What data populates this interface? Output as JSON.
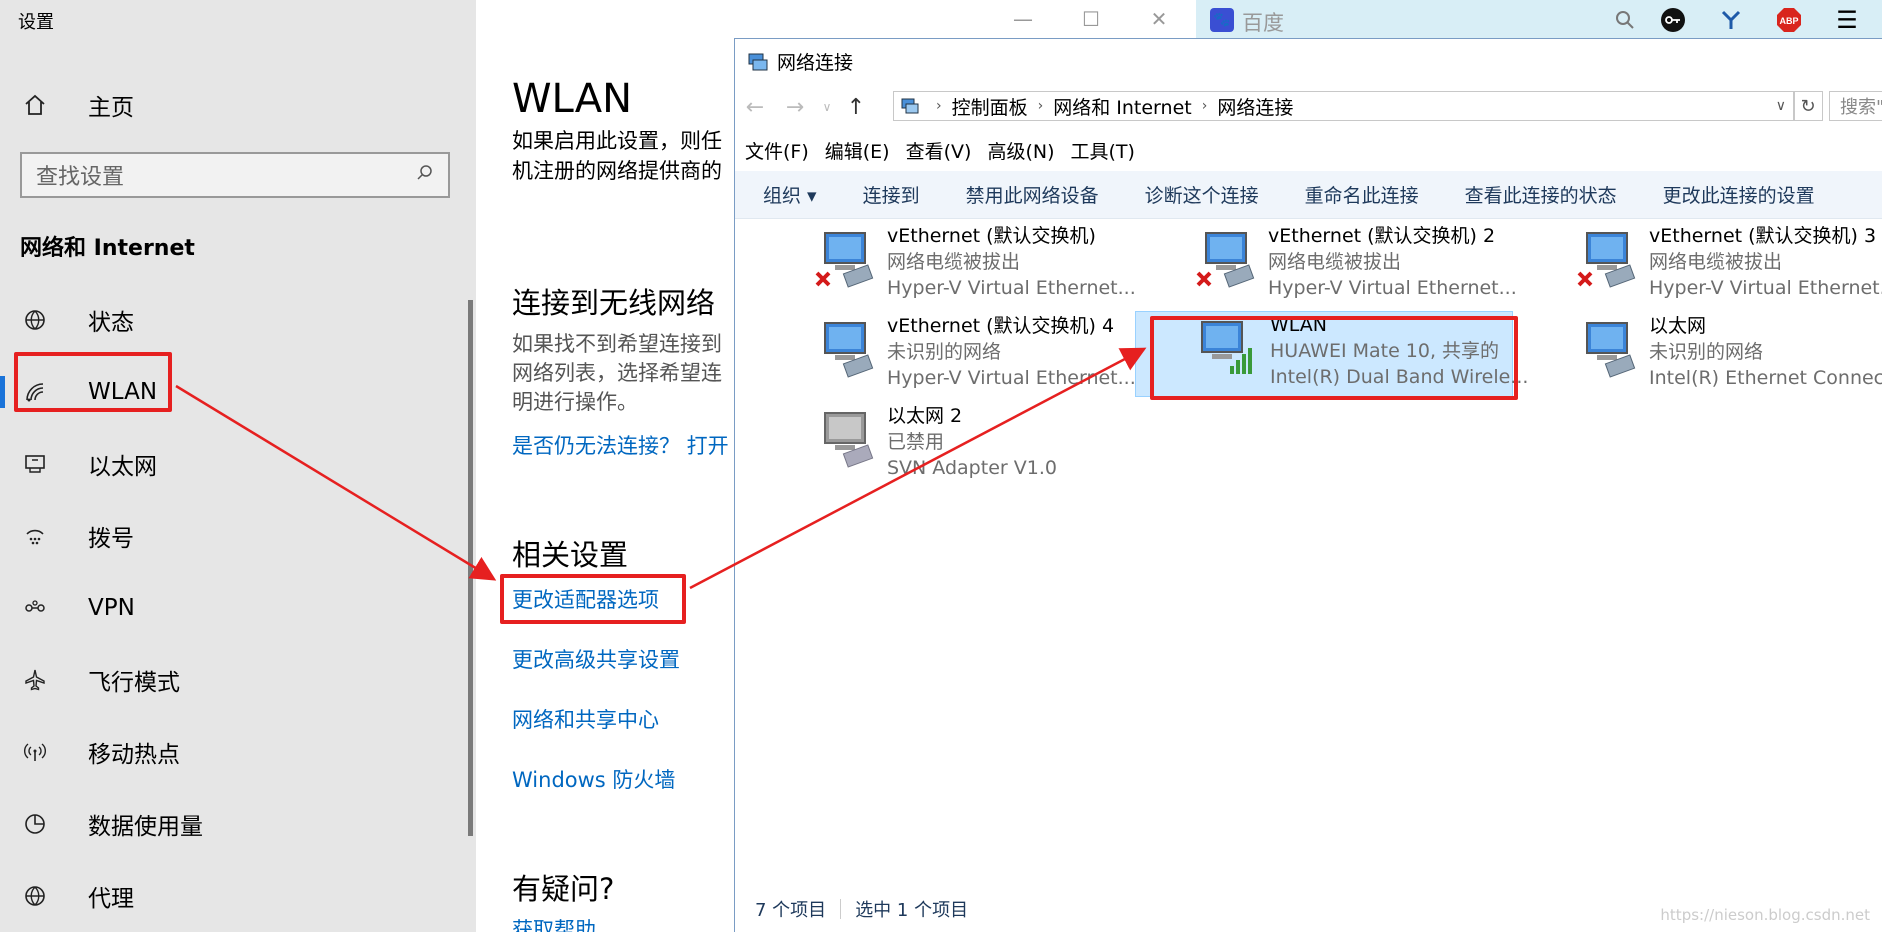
{
  "settings": {
    "window_title": "设置",
    "home_label": "主页",
    "search_placeholder": "查找设置",
    "section_heading": "网络和 Internet",
    "nav": [
      {
        "label": "状态",
        "icon": "globe-status-icon"
      },
      {
        "label": "WLAN",
        "icon": "wifi-icon"
      },
      {
        "label": "以太网",
        "icon": "ethernet-icon"
      },
      {
        "label": "拨号",
        "icon": "dialup-icon"
      },
      {
        "label": "VPN",
        "icon": "vpn-icon"
      },
      {
        "label": "飞行模式",
        "icon": "airplane-icon"
      },
      {
        "label": "移动热点",
        "icon": "hotspot-icon"
      },
      {
        "label": "数据使用量",
        "icon": "data-usage-icon"
      },
      {
        "label": "代理",
        "icon": "proxy-globe-icon"
      }
    ],
    "page_title": "WLAN",
    "intro_lines": [
      "如果启用此设置，则任",
      "机注册的网络提供商的"
    ],
    "connect_heading": "连接到无线网络",
    "connect_para": [
      "如果找不到希望连接到",
      "网络列表，选择希望连",
      "明进行操作。"
    ],
    "trouble_link": "是否仍无法连接？ 打开",
    "related_heading": "相关设置",
    "related_links": [
      "更改适配器选项",
      "更改高级共享设置",
      "网络和共享中心",
      "Windows 防火墙"
    ],
    "question_heading": "有疑问?",
    "help_link": "获取帮助"
  },
  "browser": {
    "search_text": "百度",
    "abp_label": "ABP"
  },
  "network_window": {
    "title": "网络连接",
    "breadcrumb": [
      "控制面板",
      "网络和 Internet",
      "网络连接"
    ],
    "search_placeholder": "搜索\"",
    "menu": [
      "文件(F)",
      "编辑(E)",
      "查看(V)",
      "高级(N)",
      "工具(T)"
    ],
    "commands": [
      "组织 ▾",
      "连接到",
      "禁用此网络设备",
      "诊断这个连接",
      "重命名此连接",
      "查看此连接的状态",
      "更改此连接的设置"
    ],
    "items": [
      {
        "name": "vEthernet (默认交换机)",
        "status": "网络电缆被拔出",
        "device": "Hyper-V Virtual Ethernet...",
        "state": "disconnected"
      },
      {
        "name": "vEthernet (默认交换机) 2",
        "status": "网络电缆被拔出",
        "device": "Hyper-V Virtual Ethernet...",
        "state": "disconnected"
      },
      {
        "name": "vEthernet (默认交换机) 3",
        "status": "网络电缆被拔出",
        "device": "Hyper-V Virtual Ethernet...",
        "state": "disconnected"
      },
      {
        "name": "vEthernet (默认交换机) 4",
        "status": "未识别的网络",
        "device": "Hyper-V Virtual Ethernet...",
        "state": "connected"
      },
      {
        "name": "WLAN",
        "status": "HUAWEI Mate 10, 共享的",
        "device": "Intel(R) Dual Band Wirele...",
        "state": "wifi"
      },
      {
        "name": "以太网",
        "status": "未识别的网络",
        "device": "Intel(R) Ethernet Connect...",
        "state": "connected"
      },
      {
        "name": "以太网 2",
        "status": "已禁用",
        "device": "SVN Adapter V1.0",
        "state": "disabled"
      }
    ],
    "status_count": "7 个项目",
    "status_selected": "选中 1 个项目"
  },
  "watermark": "https://nieson.blog.csdn.net",
  "colors": {
    "highlight": "#e62020",
    "link": "#0067c0",
    "selection": "#cce8ff"
  }
}
